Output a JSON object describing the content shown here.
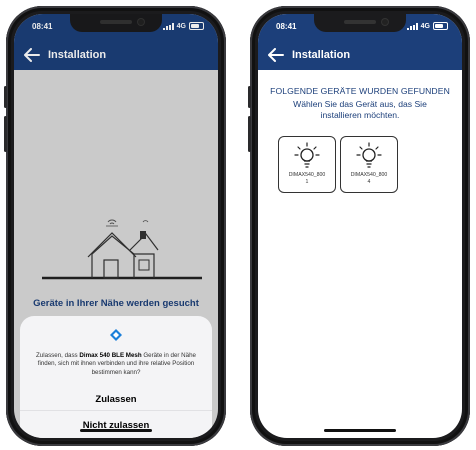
{
  "phones": {
    "left": {
      "status": {
        "time": "08:41",
        "network": "4G"
      },
      "appbar": {
        "title": "Installation"
      },
      "searching_text": "Geräte in Ihrer Nähe werden gesucht",
      "permission": {
        "text_before": "Zulassen, dass ",
        "app_name": "Dimax 540 BLE Mesh",
        "text_after": " Geräte in der Nähe finden, sich mit ihnen verbinden und ihre relative Position bestimmen kann?",
        "allow_label": "Zulassen",
        "deny_label": "Nicht zulassen"
      }
    },
    "right": {
      "status": {
        "time": "08:41",
        "network": "4G"
      },
      "appbar": {
        "title": "Installation"
      },
      "found_title": "FOLGENDE GERÄTE WURDEN GEFUNDEN",
      "found_subtitle": "Wählen Sie das Gerät aus, das Sie installieren möchten.",
      "devices": [
        {
          "name": "DIMAX540_800",
          "index": "1"
        },
        {
          "name": "DIMAX540_800",
          "index": "4"
        }
      ]
    }
  },
  "colors": {
    "brand": "#1c3f7a",
    "permission_accent": "#1a7fd9"
  },
  "icons": [
    "back-arrow-icon",
    "house-icon",
    "bluetooth-diamond-icon",
    "bulb-icon",
    "battery-icon",
    "signal-icon"
  ]
}
